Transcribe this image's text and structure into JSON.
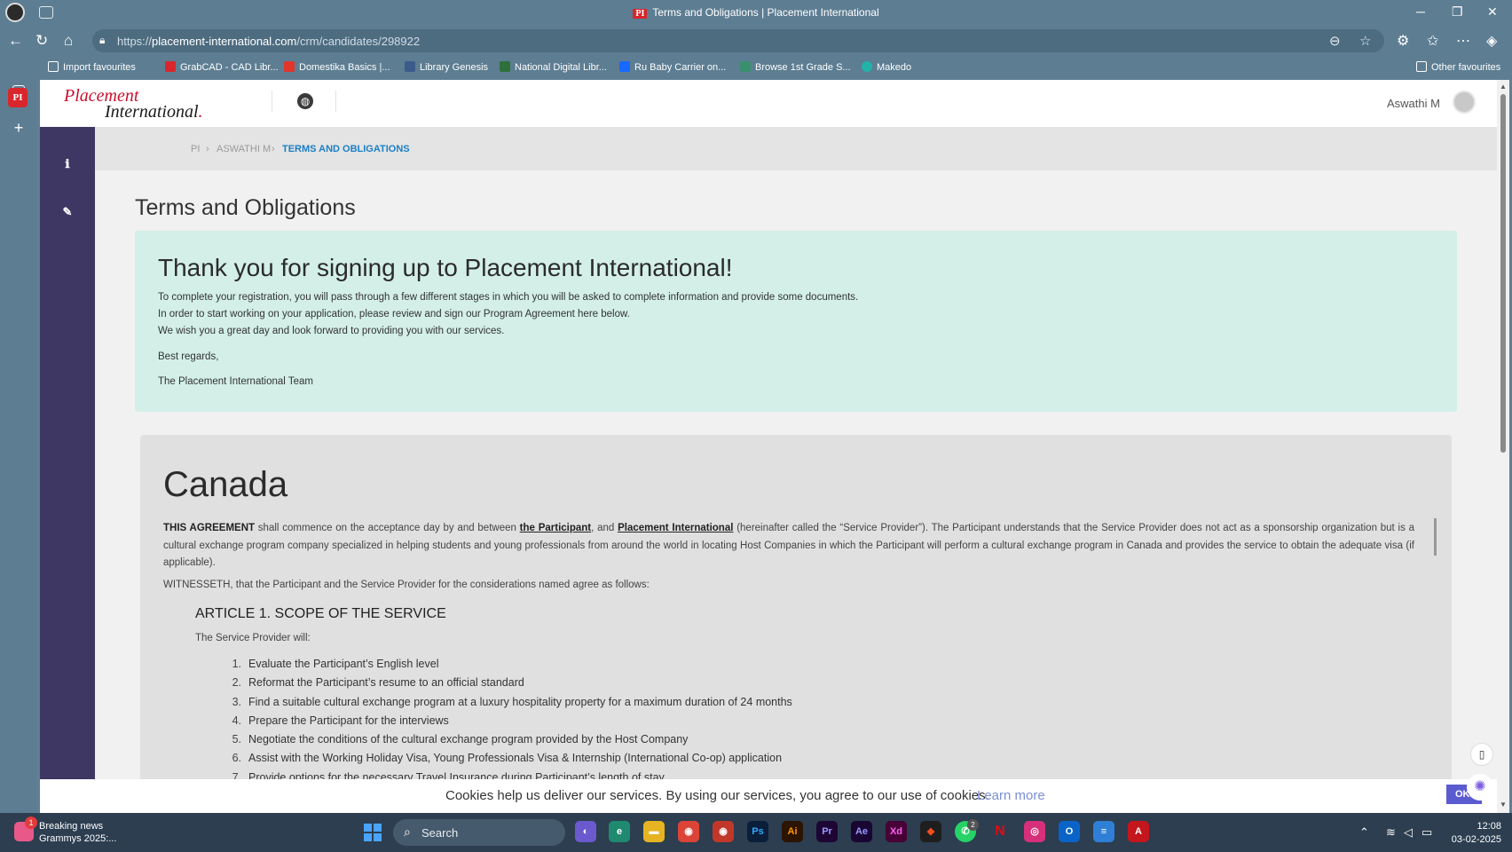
{
  "window": {
    "title": "Terms and Obligations | Placement International",
    "favicon_text": "PI"
  },
  "address": {
    "url_scheme": "https://",
    "url_domain": "placement-international.com",
    "url_path": "/crm/candidates/298922"
  },
  "bookmarks": [
    {
      "label": "Import favourites",
      "color": "#ffffff"
    },
    {
      "label": "GrabCAD - CAD Libr...",
      "color": "#d9262c"
    },
    {
      "label": "Domestika Basics |...",
      "color": "#e2352b"
    },
    {
      "label": "Library Genesis",
      "color": "#3b5b8a"
    },
    {
      "label": "National Digital Libr...",
      "color": "#2f6f3a"
    },
    {
      "label": "Ru Baby Carrier on...",
      "color": "#1769ff"
    },
    {
      "label": "Browse 1st Grade S...",
      "color": "#3a8f6e"
    },
    {
      "label": "Makedo",
      "color": "#22b3a8"
    }
  ],
  "other_favourites": "Other favourites",
  "logo": {
    "line1": "Placement",
    "line2": "International",
    "dot": "."
  },
  "user": {
    "name": "Aswathi M"
  },
  "breadcrumb": {
    "root": "PI",
    "middle": "ASWATHI M",
    "current": "TERMS AND OBLIGATIONS"
  },
  "page": {
    "title": "Terms and Obligations"
  },
  "welcome": {
    "heading": "Thank you for signing up to Placement International!",
    "line1": "To complete your registration, you will pass through a few different stages in which you will be asked to complete information and provide some documents.",
    "line2": "In order to start working on your application, please review and sign our Program Agreement here below.",
    "line3": "We wish you a great day and look forward to providing you with our services.",
    "regards": "Best regards,",
    "team": "The Placement International Team"
  },
  "agreement": {
    "country": "Canada",
    "lead_bold": "THIS AGREEMENT",
    "lead_text1": " shall commence on the acceptance day by and between ",
    "party1": "the Participant",
    "lead_text2": ", and ",
    "party2": "Placement International",
    "lead_text3": " (hereinafter called the “Service Provider”). The Participant understands that the Service Provider does not act as a sponsorship organization but is a cultural exchange program company specialized in helping students and young professionals from around the world in locating Host Companies in which the Participant will perform a cultural exchange program in Canada and provides the service to obtain the adequate visa (if applicable).",
    "witnesseth": "WITNESSETH, that the Participant and the Service Provider for the considerations named agree as follows:",
    "article1_title": "ARTICLE 1. SCOPE OF THE SERVICE",
    "article1_intro": "The Service Provider will:",
    "items": [
      "Evaluate the Participant’s English level",
      "Reformat the Participant’s resume to an official standard",
      "Find a suitable cultural exchange program at a luxury hospitality property for a maximum duration of 24 months",
      "Prepare the Participant for the interviews",
      "Negotiate the conditions of the cultural exchange program provided by the Host Company",
      "Assist with the Working Holiday Visa, Young Professionals Visa & Internship (International Co-op) application",
      "Provide options for the necessary Travel Insurance during Participant’s length of stay"
    ]
  },
  "cookie": {
    "text": "Cookies help us deliver our services. By using our services, you agree to our use of cookies.",
    "link": "Learn more",
    "ok": "OK"
  },
  "taskbar": {
    "news_title": "Breaking news",
    "news_sub": "Grammys 2025:...",
    "news_badge": "1",
    "search_placeholder": "Search",
    "time": "12:08",
    "date": "03-02-2025"
  }
}
